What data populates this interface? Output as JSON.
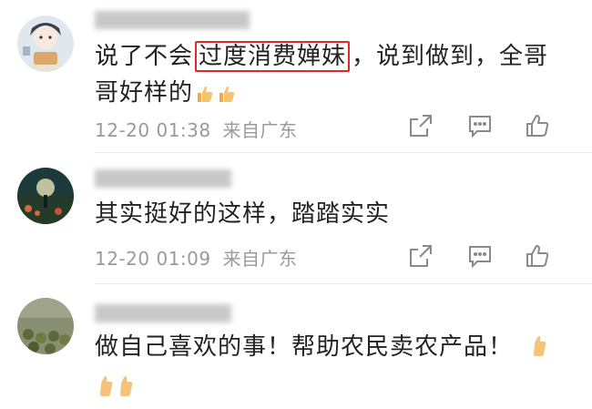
{
  "comments": [
    {
      "text_before": "说了不会",
      "text_highlight": "过度消费婵妹",
      "text_after": "，说到做到，全哥哥好样的",
      "emoji_count": 2,
      "date": "12-20 01:38",
      "location": "来自广东"
    },
    {
      "text": "其实挺好的这样，踏踏实实",
      "date": "12-20 01:09",
      "location": "来自广东"
    },
    {
      "text": "做自己喜欢的事！帮助农民卖农产品！",
      "emoji_count": 3
    }
  ],
  "icons": {
    "share": "share-icon",
    "comment": "comment-icon",
    "like": "thumbs-up-icon",
    "emoji": "thumbs-up-emoji"
  },
  "colors": {
    "highlight_border": "#e5262a",
    "text": "#222222",
    "meta": "#9a9a9a"
  }
}
